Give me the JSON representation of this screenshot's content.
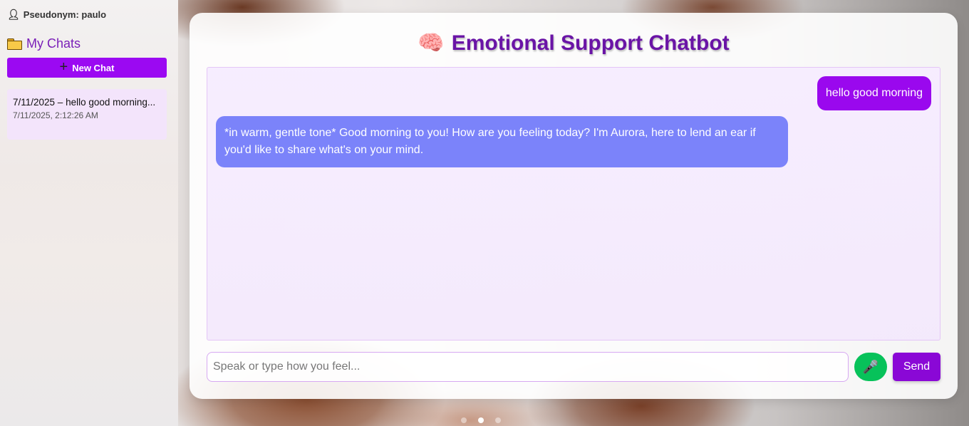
{
  "sidebar": {
    "pseudonym_label": "Pseudonym: paulo",
    "user_icon": "user-icon",
    "my_chats_label": "My Chats",
    "folder_icon": "folder-icon",
    "new_chat_label": "New Chat",
    "chats": [
      {
        "title": "7/11/2025 – hello good morning...",
        "timestamp": "7/11/2025, 2:12:26 AM"
      }
    ]
  },
  "main": {
    "title": "Emotional Support Chatbot",
    "title_icon": "brain-icon",
    "messages": [
      {
        "role": "user",
        "text": "hello good morning"
      },
      {
        "role": "bot",
        "text": "*in warm, gentle tone* Good morning to you! How are you feeling today? I'm Aurora, here to lend an ear if you'd like to share what's on your mind."
      }
    ],
    "input": {
      "value": "",
      "placeholder": "Speak or type how you feel..."
    },
    "mic_icon": "microphone-icon",
    "send_label": "Send"
  },
  "carousel": {
    "dot_count": 3,
    "active_index": 1
  },
  "colors": {
    "accent": "#9b09f2",
    "title": "#6a14a6",
    "user_bubble": "#9a08ee",
    "bot_bubble": "#7b83fa",
    "mic_button": "#07c25a",
    "send_button": "#8a08d6"
  }
}
